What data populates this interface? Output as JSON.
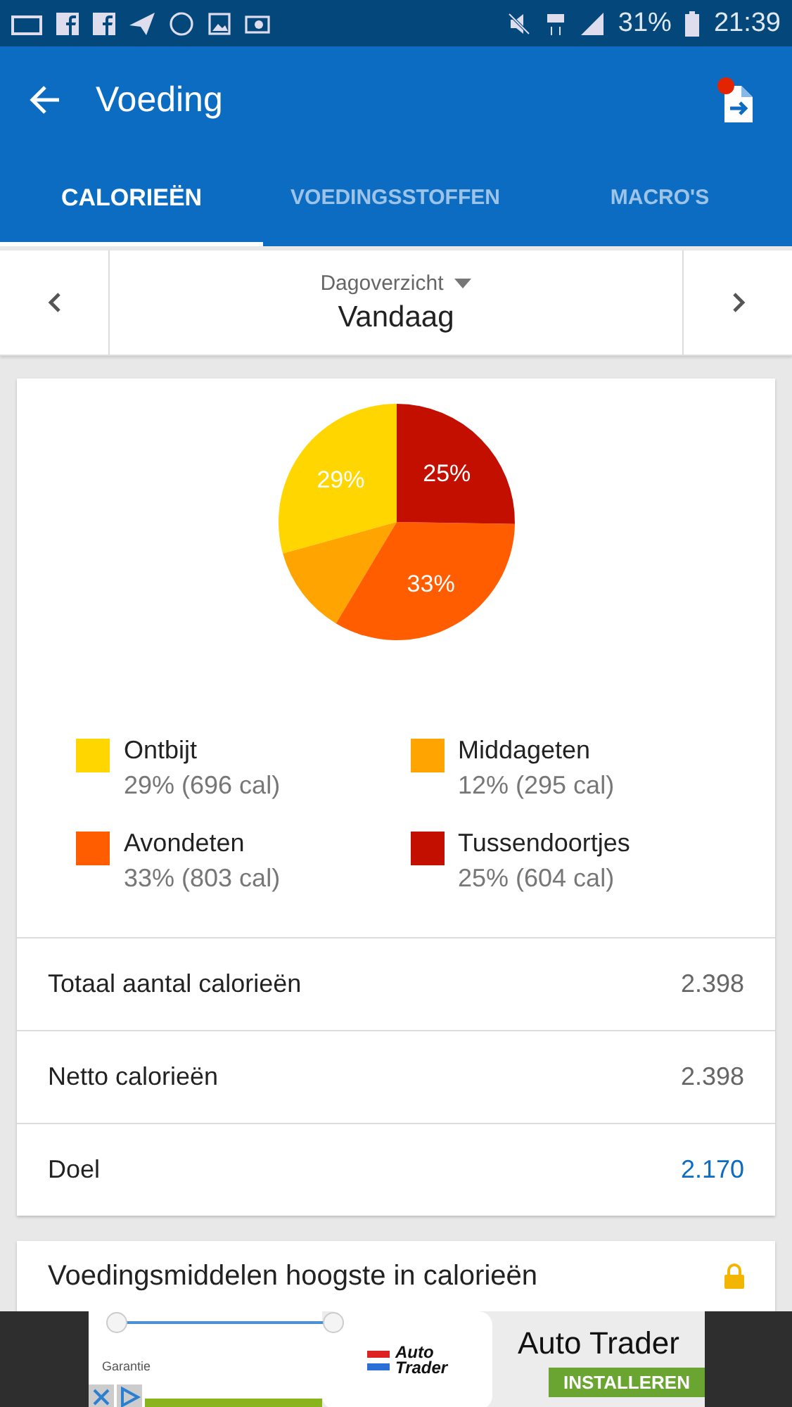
{
  "status_bar": {
    "battery": "31%",
    "time": "21:39"
  },
  "header": {
    "title": "Voeding"
  },
  "tabs": [
    {
      "label": "CALORIEËN",
      "selected": true
    },
    {
      "label": "VOEDINGSSTOFFEN",
      "selected": false
    },
    {
      "label": "MACRO'S",
      "selected": false
    }
  ],
  "date_nav": {
    "view": "Dagoverzicht",
    "day": "Vandaag"
  },
  "calories": {
    "chart_data": {
      "type": "pie",
      "categories": [
        "Ontbijt",
        "Middageten",
        "Avondeten",
        "Tussendoortjes"
      ],
      "values": [
        29,
        12,
        33,
        25
      ],
      "value_labels": [
        "29%",
        null,
        "33%",
        "25%"
      ]
    },
    "legend": [
      {
        "detail": "29% (696 cal)",
        "color": "#ffd600"
      },
      {
        "detail": "12% (295 cal)",
        "color": "#ffa400"
      },
      {
        "detail": "33% (803 cal)",
        "color": "#ff5d00"
      },
      {
        "detail": "25% (604 cal)",
        "color": "#c20f00"
      }
    ],
    "rows": [
      {
        "label": "Totaal aantal calorieën",
        "value": "2.398",
        "kind": "plain"
      },
      {
        "label": "Netto calorieën",
        "value": "2.398",
        "kind": "plain"
      },
      {
        "label": "Doel",
        "value": "2.170",
        "kind": "goal"
      }
    ]
  },
  "top_foods": {
    "title": "Voedingsmiddelen hoogste in calorieën",
    "locked": true
  },
  "ad": {
    "caption": "Garantie",
    "logo_lines": [
      "Auto",
      "Trader"
    ],
    "headline": "Auto Trader",
    "button": "INSTALLEREN"
  }
}
